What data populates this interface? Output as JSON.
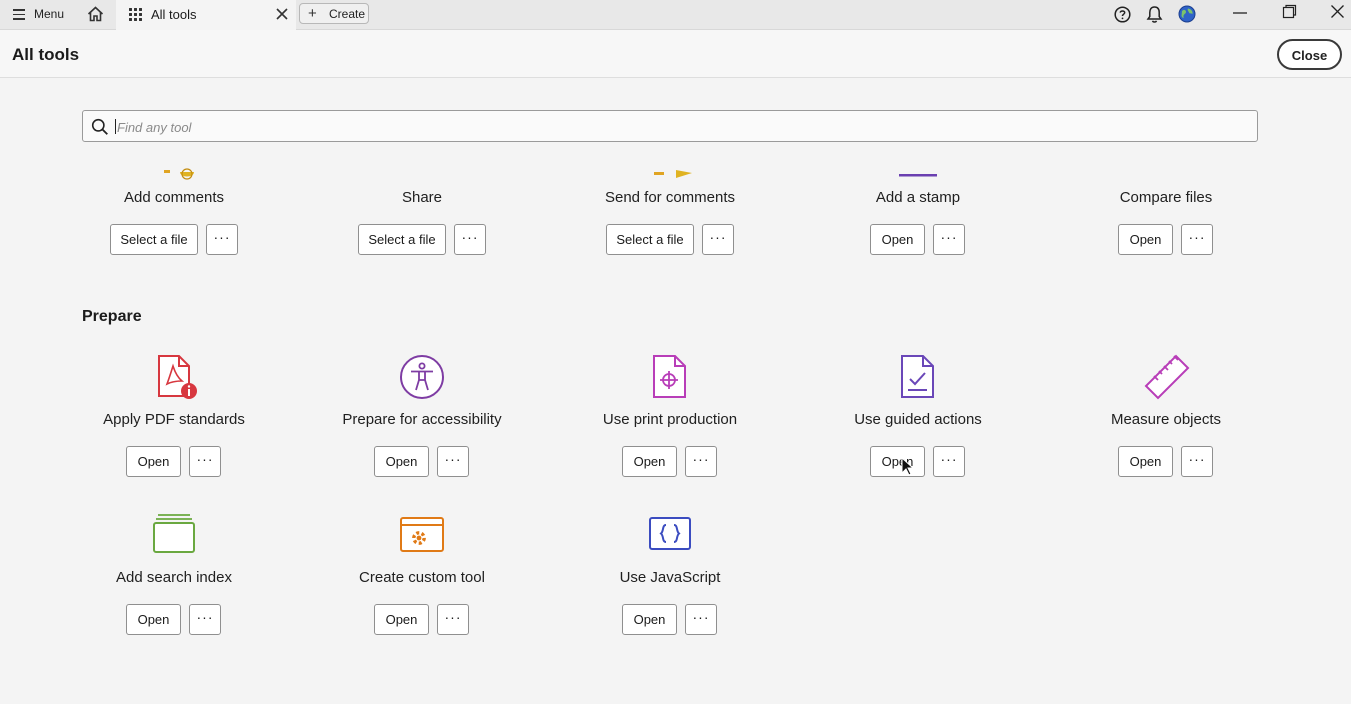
{
  "topbar": {
    "menu_label": "Menu",
    "tab_label": "All tools",
    "create_label": "Create"
  },
  "header": {
    "title": "All tools",
    "close_label": "Close"
  },
  "search": {
    "placeholder": "Find any tool"
  },
  "top_row": [
    {
      "name": "Add comments",
      "button": "Select a file",
      "more": "···"
    },
    {
      "name": "Share",
      "button": "Select a file",
      "more": "···"
    },
    {
      "name": "Send for comments",
      "button": "Select a file",
      "more": "···"
    },
    {
      "name": "Add a stamp",
      "button": "Open",
      "more": "···"
    },
    {
      "name": "Compare files",
      "button": "Open",
      "more": "···"
    }
  ],
  "prepare": {
    "title": "Prepare",
    "tools": [
      {
        "name": "Apply PDF standards",
        "icon": "pdf-standards-icon",
        "color": "#d7373f",
        "button": "Open",
        "more": "···"
      },
      {
        "name": "Prepare for accessibility",
        "icon": "accessibility-icon",
        "color": "#7e3ca3",
        "button": "Open",
        "more": "···"
      },
      {
        "name": "Use print production",
        "icon": "print-production-icon",
        "color": "#b83db8",
        "button": "Open",
        "more": "···"
      },
      {
        "name": "Use guided actions",
        "icon": "guided-actions-icon",
        "color": "#6a47b8",
        "button": "Open",
        "more": "···"
      },
      {
        "name": "Measure objects",
        "icon": "ruler-icon",
        "color": "#b83db8",
        "button": "Open",
        "more": "···"
      },
      {
        "name": "Add search index",
        "icon": "search-index-icon",
        "color": "#6aa840",
        "button": "Open",
        "more": "···"
      },
      {
        "name": "Create custom tool",
        "icon": "custom-tool-icon",
        "color": "#e07a16",
        "button": "Open",
        "more": "···"
      },
      {
        "name": "Use JavaScript",
        "icon": "javascript-icon",
        "color": "#3b4cc0",
        "button": "Open",
        "more": "···"
      }
    ]
  }
}
